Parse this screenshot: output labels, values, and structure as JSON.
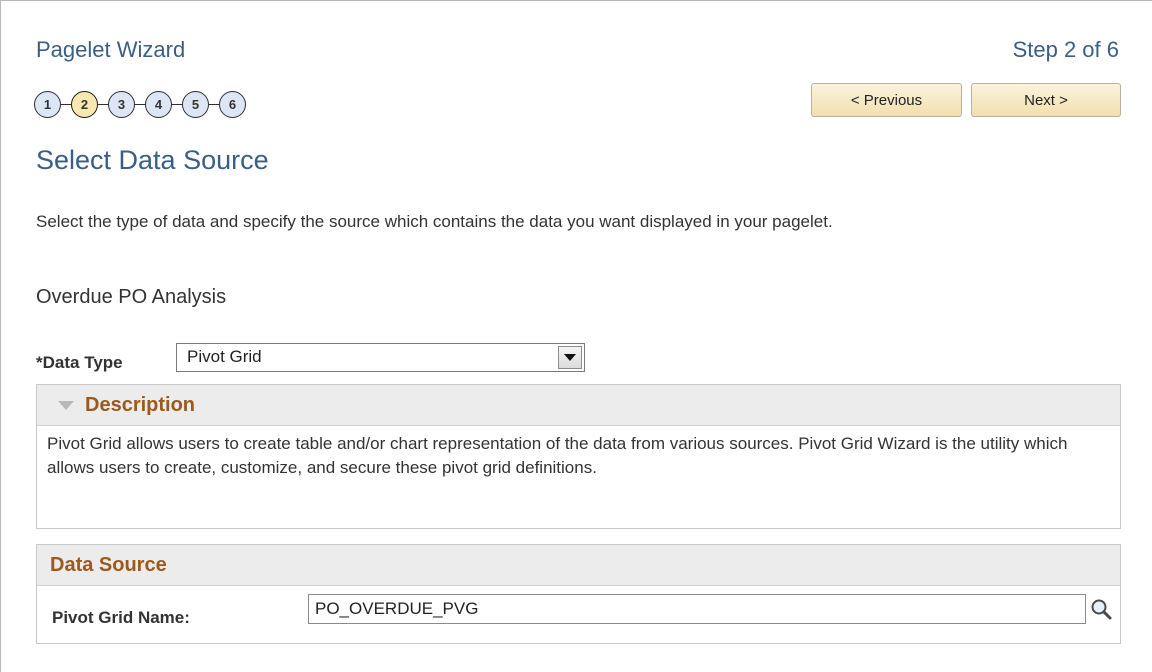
{
  "wizard": {
    "title": "Pagelet Wizard",
    "step_label": "Step 2 of 6",
    "steps": [
      "1",
      "2",
      "3",
      "4",
      "5",
      "6"
    ],
    "current_step": 2
  },
  "nav": {
    "previous_label": "< Previous",
    "next_label": "Next >"
  },
  "page": {
    "title": "Select Data Source",
    "intro": "Select the type of data and specify the source which contains the data you want displayed in your pagelet.",
    "pagelet_name": "Overdue PO Analysis"
  },
  "data_type": {
    "required_mark": "*",
    "label": "Data Type",
    "value": "Pivot Grid"
  },
  "description_panel": {
    "title": "Description",
    "text": "Pivot Grid allows users to create table and/or chart representation of the data from various sources. Pivot Grid Wizard is the utility which allows users to create, customize, and secure these pivot grid definitions."
  },
  "data_source_panel": {
    "title": "Data Source",
    "field_label": "Pivot Grid Name:",
    "field_value": "PO_OVERDUE_PVG",
    "search_icon": "search-icon"
  },
  "colors": {
    "accent_blue": "#3a5f86",
    "section_title": "#9b5a1c",
    "current_step_fill": "#f7e7b0",
    "step_fill": "#dde6f5"
  }
}
